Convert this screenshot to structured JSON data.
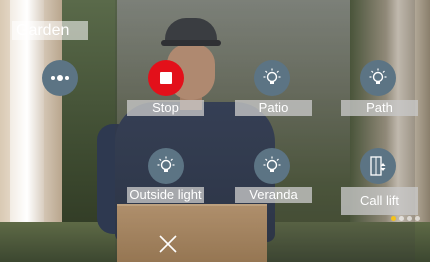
{
  "screen": {
    "title": "Garden"
  },
  "controls": {
    "stop": {
      "label": "Stop",
      "icon": "stop-icon",
      "color": "#e3101a"
    },
    "patio": {
      "label": "Patio",
      "icon": "lightbulb-icon"
    },
    "path": {
      "label": "Path",
      "icon": "lightbulb-icon"
    },
    "outside_light": {
      "label": "Outside light",
      "icon": "lightbulb-icon"
    },
    "veranda": {
      "label": "Veranda",
      "icon": "lightbulb-icon"
    },
    "call_lift": {
      "label": "Call lift",
      "icon": "elevator-icon"
    },
    "more": {
      "icon": "dots-icon"
    },
    "close": {
      "icon": "close-icon"
    }
  },
  "pager": {
    "pages": 4,
    "active": 1
  },
  "colors": {
    "button_bg": "#5c7484",
    "accent": "#f4c21a",
    "stop": "#e3101a"
  }
}
